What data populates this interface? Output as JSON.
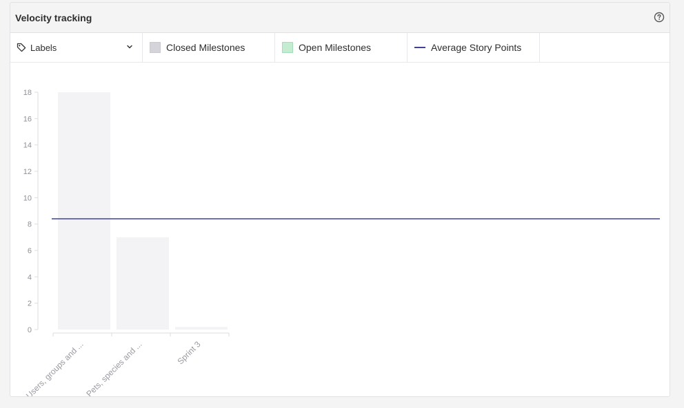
{
  "panel": {
    "title": "Velocity tracking",
    "help_icon": "question-circle-icon"
  },
  "toolbar": {
    "labels_select": {
      "label": "Labels",
      "icon": "tag-icon",
      "chevron": "chevron-down-icon"
    },
    "legend": [
      {
        "label": "Closed Milestones",
        "kind": "swatch",
        "color": "#d4d4da"
      },
      {
        "label": "Open Milestones",
        "kind": "swatch",
        "color": "#c3ecd1"
      },
      {
        "label": "Average Story Points",
        "kind": "line",
        "color": "#3f3f9c"
      }
    ]
  },
  "chart_data": {
    "type": "bar",
    "categories": [
      "Users, groups and ...",
      "Pets, species and ...",
      "Sprint 3"
    ],
    "series": [
      {
        "name": "Closed Milestones",
        "values": [
          18,
          7,
          0.2
        ],
        "color": "#f3f3f6"
      }
    ],
    "average_line": {
      "name": "Average Story Points",
      "value": 8.4,
      "color": "#3f3f9c"
    },
    "yticks": [
      0,
      2,
      4,
      6,
      8,
      10,
      12,
      14,
      16,
      18
    ],
    "ylim": [
      0,
      18
    ],
    "grid": false,
    "xlabel": "",
    "ylabel": ""
  }
}
